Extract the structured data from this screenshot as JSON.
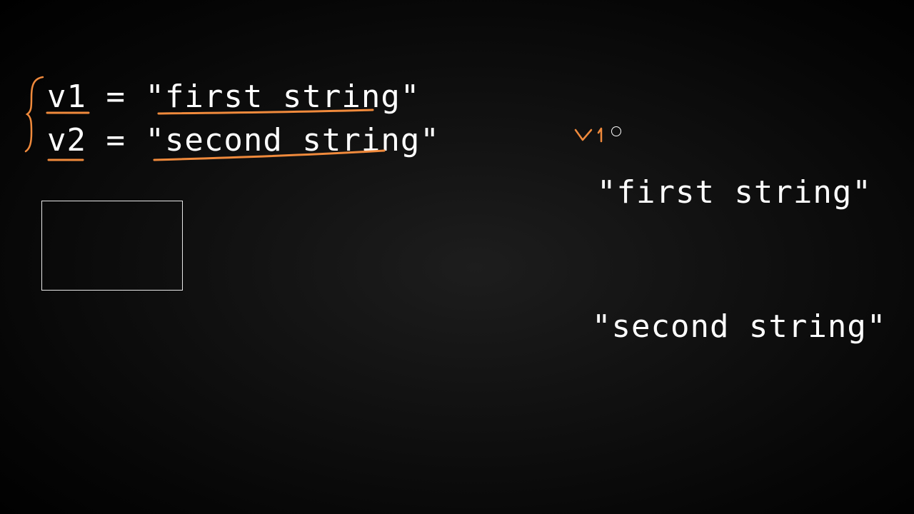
{
  "code": {
    "line1": "v1 = \"first string\"",
    "line2": "v2 = \"second string\""
  },
  "memory": {
    "string1": "\"first string\"",
    "string2": "\"second string\"",
    "handwritten_label": "v1"
  },
  "colors": {
    "annotation": "#f08a3c",
    "text": "#ffffff",
    "background": "#000000"
  }
}
